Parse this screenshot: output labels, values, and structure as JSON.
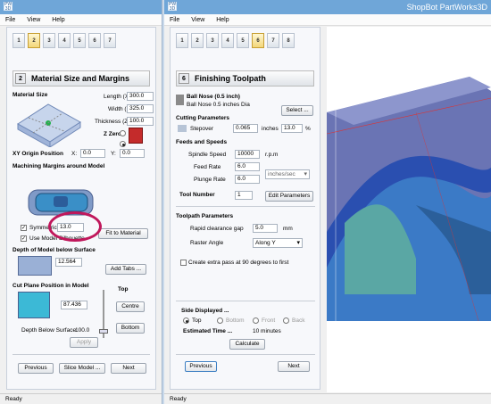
{
  "left": {
    "menu": [
      "File",
      "View",
      "Help"
    ],
    "steps": [
      "1",
      "2",
      "3",
      "4",
      "5",
      "6",
      "7"
    ],
    "section": {
      "num": "2",
      "title": "Material Size and Margins"
    },
    "material_size": "Material Size",
    "length_label": "Length (X):",
    "length": "300.0",
    "width_label": "Width (Y):",
    "width": "325.0",
    "thickness_label": "Thickness (Z):",
    "thickness": "100.0",
    "zzero": "Z Zero",
    "xy_origin": "XY Origin Position",
    "x_label": "X:",
    "x": "0.0",
    "y_label": "Y:",
    "y": "0.0",
    "machining_margins": "Machining Margins around Model",
    "symmetrical": "Symmetrical",
    "use_model_silhouette": "Use Model Silhouette",
    "margin": "13.0",
    "fit_to_material": "Fit to Material",
    "depth_below_surface": "Depth of Model below Surface",
    "depth": "12.564",
    "add_tabs": "Add Tabs ...",
    "cut_plane": "Cut Plane Position in Model",
    "top": "Top",
    "cut_value": "87.436",
    "centre": "Centre",
    "bottom": "Bottom",
    "depth_below_surface_label": "Depth Below Surface:",
    "depth_below_surface_value": "100.0",
    "apply": "Apply",
    "previous": "Previous",
    "slice_model": "Slice Model ...",
    "next": "Next",
    "status": "Ready"
  },
  "right": {
    "app_title": "ShopBot PartWorks3D",
    "menu": [
      "File",
      "View",
      "Help"
    ],
    "steps": [
      "1",
      "2",
      "3",
      "4",
      "5",
      "6",
      "7",
      "8"
    ],
    "section": {
      "num": "6",
      "title": "Finishing Toolpath"
    },
    "tool_name": "Ball Nose (0.5 inch)",
    "tool_desc": "Ball Nose 0.5 inches Dia",
    "select": "Select ...",
    "cutting_params": "Cutting Parameters",
    "stepover_label": "Stepover",
    "stepover": "0.065",
    "stepover_unit": "inches",
    "stepover_pct": "13.0",
    "pct": "%",
    "feeds_speeds": "Feeds and Speeds",
    "spindle_label": "Spindle Speed",
    "spindle": "10000",
    "rpm": "r.p.m",
    "feed_label": "Feed Rate",
    "feed": "6.0",
    "feed_unit": "inches/sec",
    "plunge_label": "Plunge Rate",
    "plunge": "6.0",
    "tool_number_label": "Tool Number",
    "tool_number": "1",
    "edit_params": "Edit Parameters",
    "toolpath_params": "Toolpath Parameters",
    "rapid_label": "Rapid clearance gap",
    "rapid": "5.0",
    "mm": "mm",
    "raster_label": "Raster Angle",
    "raster": "Along Y",
    "extra_pass": "Create extra pass at 90 degrees to first",
    "side_displayed": "Side Displayed ...",
    "side_top": "Top",
    "side_bottom": "Bottom",
    "side_front": "Front",
    "side_back": "Back",
    "est_time_label": "Estimated Time ...",
    "est_time": "10 minutes",
    "calculate": "Calculate",
    "previous": "Previous",
    "next": "Next",
    "status": "Ready"
  },
  "colors": {
    "titlebar": "#6fa6d8",
    "highlight_circle": "#c0175b",
    "viewport_bg": "#6a74b4"
  }
}
